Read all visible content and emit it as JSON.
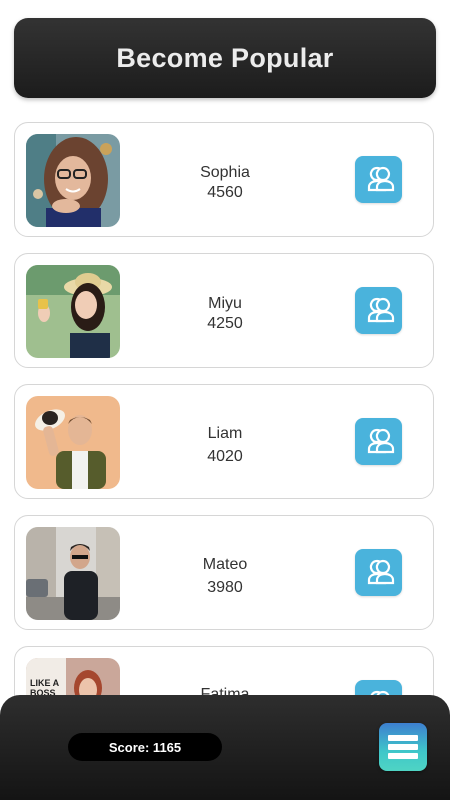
{
  "header": {
    "title": "Become Popular"
  },
  "players": [
    {
      "name": "Sophia",
      "score": "4560",
      "photo": "woman-with-glasses-photo"
    },
    {
      "name": "Miyu",
      "score": "4250",
      "photo": "woman-with-hat-selfie-photo"
    },
    {
      "name": "Liam",
      "score": "4020",
      "photo": "man-with-hat-photo"
    },
    {
      "name": "Mateo",
      "score": "3980",
      "photo": "man-on-street-photo"
    },
    {
      "name": "Fatima",
      "score": "",
      "photo": "woman-portrait-photo"
    }
  ],
  "follow_icon": "add-friend-icon",
  "bottom_bar": {
    "score_label": "Score: 1165",
    "menu_icon": "menu-icon"
  },
  "colors": {
    "accent": "#4ab3dc",
    "header_bg": "#262626",
    "menu_gradient": [
      "#3d7fd0",
      "#4fd4c4"
    ]
  }
}
